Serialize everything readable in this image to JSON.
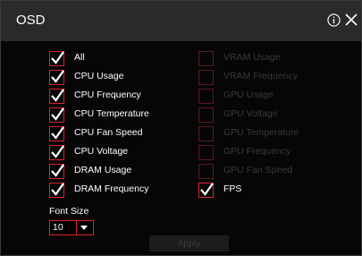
{
  "dialog": {
    "title": "OSD",
    "info_icon": "info-circle-icon",
    "close_icon": "close-icon"
  },
  "options_left": [
    {
      "label": "All",
      "checked": true,
      "enabled": true
    },
    {
      "label": "CPU Usage",
      "checked": true,
      "enabled": true
    },
    {
      "label": "CPU Frequency",
      "checked": true,
      "enabled": true
    },
    {
      "label": "CPU Temperature",
      "checked": true,
      "enabled": true
    },
    {
      "label": "CPU Fan Speed",
      "checked": true,
      "enabled": true
    },
    {
      "label": "CPU Voltage",
      "checked": true,
      "enabled": true
    },
    {
      "label": "DRAM Usage",
      "checked": true,
      "enabled": true
    },
    {
      "label": "DRAM Frequency",
      "checked": true,
      "enabled": true
    }
  ],
  "options_right": [
    {
      "label": "VRAM Usage",
      "checked": false,
      "enabled": false
    },
    {
      "label": "VRAM Frequency",
      "checked": false,
      "enabled": false
    },
    {
      "label": "GPU Usage",
      "checked": false,
      "enabled": false
    },
    {
      "label": "GPU Voltage",
      "checked": false,
      "enabled": false
    },
    {
      "label": "GPU Temperature",
      "checked": false,
      "enabled": false
    },
    {
      "label": "GPU Frequency",
      "checked": false,
      "enabled": false
    },
    {
      "label": "GPU Fan Speed",
      "checked": false,
      "enabled": false
    },
    {
      "label": "FPS",
      "checked": true,
      "enabled": true
    }
  ],
  "font_size": {
    "label": "Font Size",
    "value": "10"
  },
  "apply_label": "Apply",
  "colors": {
    "accent": "#d9232d",
    "background": "#060606",
    "titlebar": "#2a2a2a",
    "text": "#ffffff",
    "disabled_text": "#3a3a3a"
  }
}
